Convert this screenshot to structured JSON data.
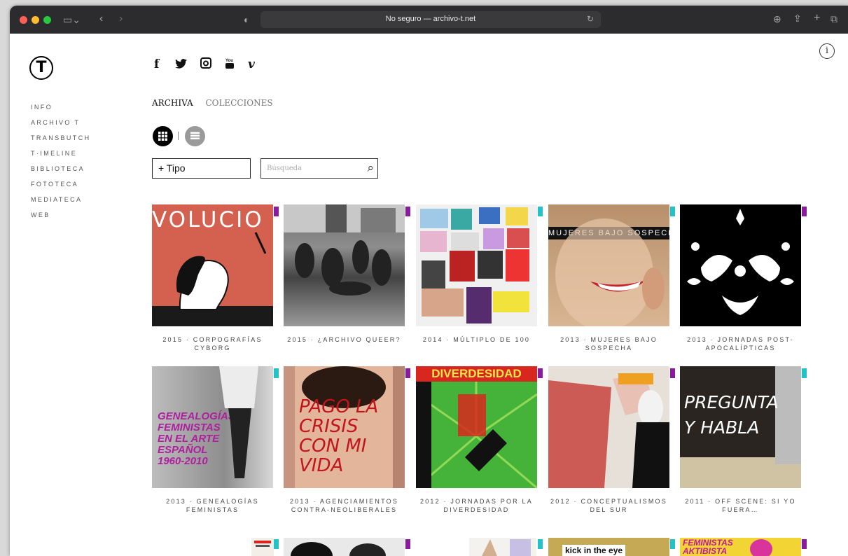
{
  "browser": {
    "url_text": "No seguro — archivo-t.net"
  },
  "site": {
    "logo_letter": "T",
    "info_label": "i",
    "nav": [
      "INFO",
      "ARCHIVO T",
      "TRANSBUTCH",
      "T·IMELINE",
      "BIBLIOTECA",
      "FOTOTECA",
      "MEDIATECA",
      "WEB"
    ],
    "social": [
      "f",
      "🐦",
      "📷",
      "▶",
      "v"
    ],
    "tabs": {
      "active": "ARCHIVA",
      "other": "COLECCIONES"
    },
    "filter": {
      "tipo_label": "+ Tipo",
      "search_placeholder": "Búsqueda"
    }
  },
  "items": [
    {
      "caption": "2015 · CORPOGRAFÍAS CYBORG",
      "tag_color": "#8b1a9e",
      "image_text": "VOLUCIO"
    },
    {
      "caption": "2015 · ¿ARCHIVO QUEER?",
      "tag_color": "#8b1a9e",
      "image_text": ""
    },
    {
      "caption": "2014 · MÚLTIPLO DE 100",
      "tag_color": "#22c3c7",
      "image_text": ""
    },
    {
      "caption": "2013 · MUJERES BAJO SOSPECHA",
      "tag_color": "#22c3c7",
      "image_text": "MUJERES BAJO SOSPECHA"
    },
    {
      "caption": "2013 · JORNADAS POST-APOCALÍPTICAS",
      "tag_color": "#8b1a9e",
      "image_text": ""
    },
    {
      "caption": "2013 · GENEALOGÍAS FEMINISTAS",
      "tag_color": "#22c3c7",
      "image_text": "GENEALOGÍAS FEMINISTAS EN EL ARTE ESPAÑOL 1960-2010"
    },
    {
      "caption": "2013 · AGENCIAMIENTOS CONTRA-NEOLIBERALES",
      "tag_color": "#8b1a9e",
      "image_text": "PAGO LA CRISIS CON MI VIDA"
    },
    {
      "caption": "2012 · JORNADAS POR LA DIVERDESIDAD",
      "tag_color": "#8b1a9e",
      "image_text": "DIVERDESIDAD"
    },
    {
      "caption": "2012 · CONCEPTUALISMOS DEL SUR",
      "tag_color": "#8b1a9e",
      "image_text": ""
    },
    {
      "caption": "2011 · OFF SCENE: SI YO FUERA…",
      "tag_color": "#22c3c7",
      "image_text": "PREGUNTA Y HABLA"
    }
  ],
  "partial_row": {
    "tag_colors": [
      "#22c3c7",
      "#8b1a9e",
      "#22c3c7",
      "#22c3c7",
      "#8b1a9e"
    ],
    "texts": [
      "kick in the eye",
      "FEMINISTAS AKTIBISTA"
    ]
  }
}
